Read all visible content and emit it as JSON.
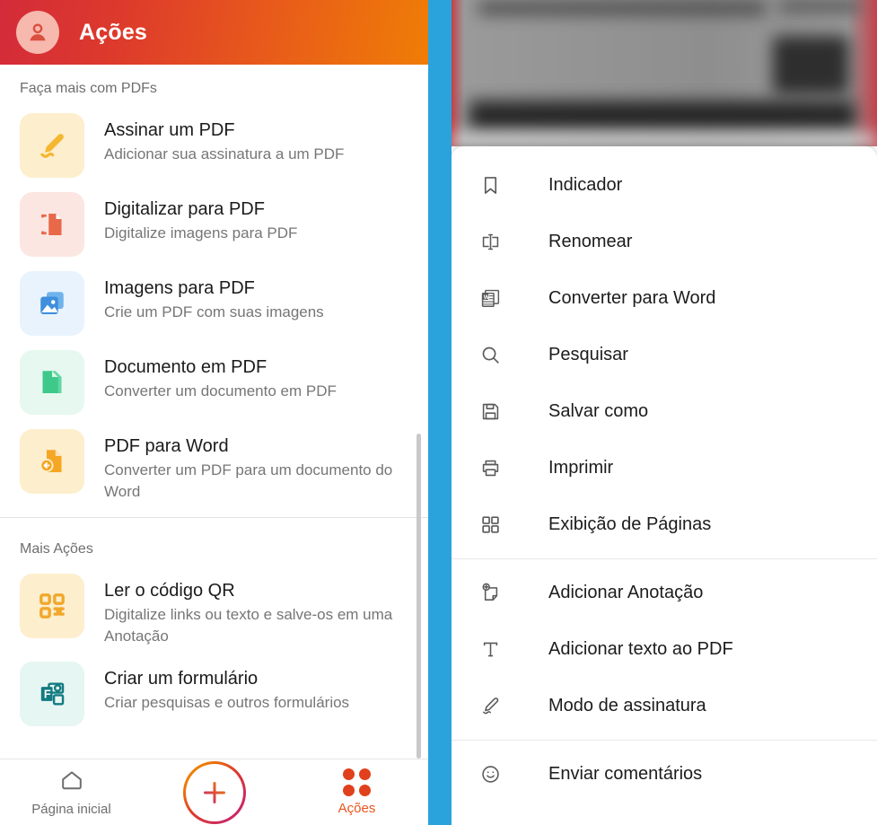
{
  "app": {
    "header_title": "Ações",
    "avatar_icon": "person-circle-icon",
    "brand_gradient_from": "#d42b3a",
    "brand_gradient_to": "#ef7d06"
  },
  "left_panel": {
    "sections": [
      {
        "label": "Faça mais com PDFs",
        "items": [
          {
            "icon": "pen-signature-icon",
            "tile_bg": "#fdeecd",
            "icon_color": "#f5b731",
            "title": "Assinar um PDF",
            "subtitle": "Adicionar sua assinatura a um PDF"
          },
          {
            "icon": "scan-to-pdf-icon",
            "tile_bg": "#fbe6e2",
            "icon_color": "#e8684a",
            "title": "Digitalizar para PDF",
            "subtitle": "Digitalize imagens para PDF"
          },
          {
            "icon": "image-to-pdf-icon",
            "tile_bg": "#e9f3fd",
            "icon_color": "#4496e0",
            "title": "Imagens para PDF",
            "subtitle": "Crie um PDF com suas imagens"
          },
          {
            "icon": "document-to-pdf-icon",
            "tile_bg": "#e6f8ef",
            "icon_color": "#45cc8a",
            "title": "Documento em PDF",
            "subtitle": "Converter um documento em PDF"
          },
          {
            "icon": "pdf-to-word-icon",
            "tile_bg": "#fdeecd",
            "icon_color": "#f5a623",
            "title": "PDF para Word",
            "subtitle": "Converter um PDF para um documento do Word"
          }
        ]
      },
      {
        "label": "Mais Ações",
        "items": [
          {
            "icon": "qr-code-icon",
            "tile_bg": "#fdeecd",
            "icon_color": "#f0a82b",
            "title": "Ler o código QR",
            "subtitle": "Digitalize links ou texto e salve-os em uma Anotação"
          },
          {
            "icon": "create-form-icon",
            "tile_bg": "#e6f6f2",
            "icon_color": "#137b82",
            "title": "Criar um formulário",
            "subtitle": "Criar pesquisas e outros formulários"
          }
        ]
      }
    ]
  },
  "bottom_nav": {
    "items": [
      {
        "icon": "home-icon",
        "label": "Página inicial",
        "active": false
      },
      {
        "icon": "plus-icon",
        "label": "",
        "active": false
      },
      {
        "icon": "grid-dots-icon",
        "label": "Ações",
        "active": true
      }
    ],
    "active_color": "#e8551f",
    "inactive_color": "#6d6d6d"
  },
  "right_panel": {
    "menu_groups": [
      {
        "items": [
          {
            "icon": "bookmark-icon",
            "label": "Indicador"
          },
          {
            "icon": "rename-icon",
            "label": "Renomear"
          },
          {
            "icon": "word-doc-icon",
            "label": "Converter para Word"
          },
          {
            "icon": "search-icon",
            "label": "Pesquisar"
          },
          {
            "icon": "save-floppy-icon",
            "label": "Salvar como"
          },
          {
            "icon": "printer-icon",
            "label": "Imprimir"
          },
          {
            "icon": "pages-grid-icon",
            "label": "Exibição de Páginas"
          }
        ]
      },
      {
        "items": [
          {
            "icon": "add-note-icon",
            "label": "Adicionar Anotação"
          },
          {
            "icon": "text-tool-icon",
            "label": "Adicionar texto ao PDF"
          },
          {
            "icon": "signature-pen-icon",
            "label": "Modo de assinatura"
          }
        ]
      },
      {
        "items": [
          {
            "icon": "smiley-feedback-icon",
            "label": "Enviar comentários"
          }
        ]
      }
    ]
  }
}
